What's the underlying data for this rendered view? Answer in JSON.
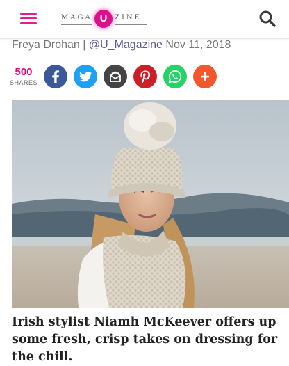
{
  "header": {
    "logo_left": "MAGA",
    "logo_letter": "U",
    "logo_right": "ZINE",
    "brand_color": "#d90f8c",
    "menu_icon": "hamburger-menu-icon",
    "search_icon": "search-icon"
  },
  "byline": {
    "author": "Freya Drohan",
    "separator": " | ",
    "handle": "@U_Magazine",
    "date": "Nov 11, 2018"
  },
  "share": {
    "count": "500",
    "label": "SHARES",
    "buttons": [
      {
        "name": "facebook",
        "icon": "facebook-icon",
        "color": "#3b5998"
      },
      {
        "name": "twitter",
        "icon": "twitter-bird-icon",
        "color": "#1da1f2"
      },
      {
        "name": "email",
        "icon": "envelope-icon",
        "color": "#444444"
      },
      {
        "name": "pinterest",
        "icon": "pinterest-icon",
        "color": "#cb2027"
      },
      {
        "name": "whatsapp",
        "icon": "whatsapp-icon",
        "color": "#25d366"
      },
      {
        "name": "more",
        "icon": "plus-icon",
        "color": "#f2582c"
      }
    ]
  },
  "article": {
    "headline": "Irish stylist Niamh McKeever offers up some fresh, crisp takes on dressing for the chill."
  }
}
